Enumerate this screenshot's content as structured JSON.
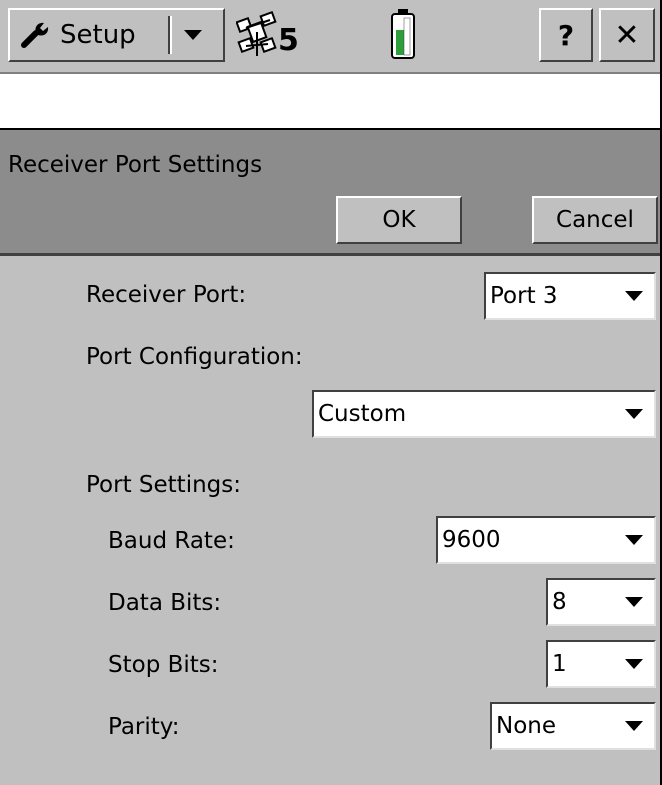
{
  "topbar": {
    "setup_label": "Setup",
    "satellite_count": "5",
    "help_label": "?",
    "close_label": "✕"
  },
  "dialog": {
    "title": "Receiver Port Settings",
    "ok_label": "OK",
    "cancel_label": "Cancel"
  },
  "form": {
    "receiver_port_label": "Receiver Port:",
    "receiver_port_value": "Port 3",
    "port_config_label": "Port Configuration:",
    "port_config_value": "Custom",
    "port_settings_label": "Port Settings:",
    "baud_rate_label": "Baud Rate:",
    "baud_rate_value": "9600",
    "data_bits_label": "Data Bits:",
    "data_bits_value": "8",
    "stop_bits_label": "Stop Bits:",
    "stop_bits_value": "1",
    "parity_label": "Parity:",
    "parity_value": "None"
  },
  "colors": {
    "background": "#c0c0c0",
    "header": "#8c8c8c",
    "battery": "#2e9e3a"
  },
  "icons": {
    "setup": "wrench-icon",
    "satellite": "satellite-icon",
    "battery": "battery-icon"
  }
}
